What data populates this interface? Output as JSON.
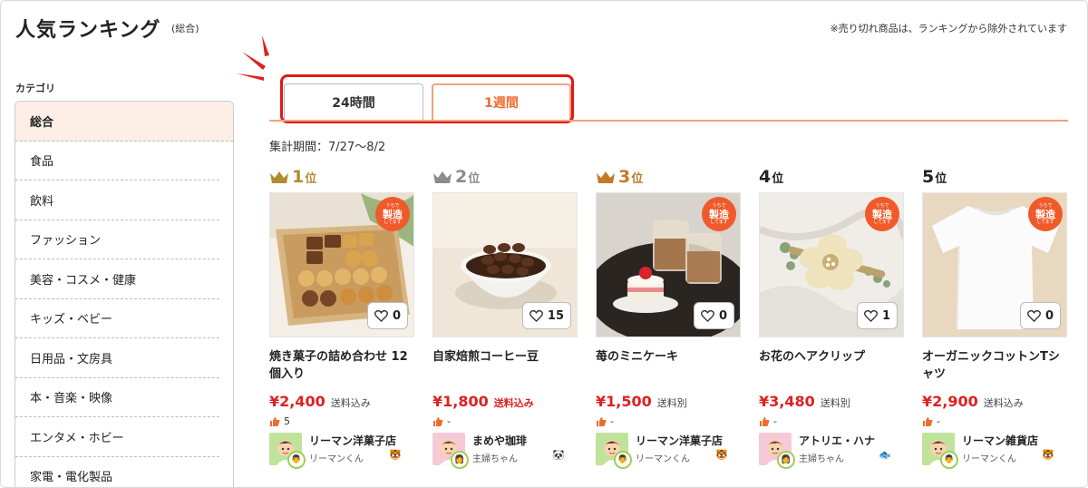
{
  "header": {
    "title": "人気ランキング",
    "subtitle": "(総合)",
    "note": "※売り切れ商品は、ランキングから除外されています"
  },
  "sidebar": {
    "heading": "カテゴリ",
    "items": [
      {
        "label": "総合",
        "active": true
      },
      {
        "label": "食品"
      },
      {
        "label": "飲料"
      },
      {
        "label": "ファッション"
      },
      {
        "label": "美容・コスメ・健康"
      },
      {
        "label": "キッズ・ベビー"
      },
      {
        "label": "日用品・文房具"
      },
      {
        "label": "本・音楽・映像"
      },
      {
        "label": "エンタメ・ホビー"
      },
      {
        "label": "家電・電化製品"
      }
    ]
  },
  "tabs": [
    {
      "label": "24時間"
    },
    {
      "label": "1週間",
      "selected": true
    }
  ],
  "period": "集計期間：7/27〜8/2",
  "badge": {
    "line1": "うちで",
    "line2": "製造",
    "line3": "してます"
  },
  "colors": {
    "accent": "#f06b2e",
    "price": "#e02020",
    "highlight": "#e01818",
    "gold": "#b08d2e",
    "silver": "#8c8c8c",
    "bronze": "#c57a2a"
  },
  "products": [
    {
      "rank": "1",
      "suffix": "位",
      "crown": "gold",
      "name": "焼き菓子の詰め合わせ 12個入り",
      "price": "¥2,400",
      "shipping": "送料込み",
      "shipping_emphasis": false,
      "favorites": "0",
      "likes": "5",
      "shop": "リーマン洋菓子店",
      "seller_type": "リーマンくん",
      "type_icon": "🐯",
      "made_badge": true,
      "image": "cookies"
    },
    {
      "rank": "2",
      "suffix": "位",
      "crown": "silver",
      "name": "自家焙煎コーヒー豆",
      "price": "¥1,800",
      "shipping": "送料込み",
      "shipping_emphasis": true,
      "favorites": "15",
      "likes": "-",
      "shop": "まめや珈琲",
      "seller_type": "主婦ちゃん",
      "type_icon": "🐼",
      "made_badge": false,
      "image": "coffee"
    },
    {
      "rank": "3",
      "suffix": "位",
      "crown": "bronze",
      "name": "苺のミニケーキ",
      "price": "¥1,500",
      "shipping": "送料別",
      "shipping_emphasis": false,
      "favorites": "0",
      "likes": "-",
      "shop": "リーマン洋菓子店",
      "seller_type": "リーマンくん",
      "type_icon": "🐯",
      "made_badge": true,
      "image": "cake"
    },
    {
      "rank": "4",
      "suffix": "位",
      "crown": "",
      "name": "お花のヘアクリップ",
      "price": "¥3,480",
      "shipping": "送料別",
      "shipping_emphasis": false,
      "favorites": "1",
      "likes": "-",
      "shop": "アトリエ・ハナ",
      "seller_type": "主婦ちゃん",
      "type_icon": "🐟",
      "made_badge": true,
      "image": "flower"
    },
    {
      "rank": "5",
      "suffix": "位",
      "crown": "",
      "name": "オーガニックコットンTシャツ",
      "price": "¥2,900",
      "shipping": "送料込み",
      "shipping_emphasis": false,
      "favorites": "0",
      "likes": "-",
      "shop": "リーマン雑貨店",
      "seller_type": "リーマンくん",
      "type_icon": "🐯",
      "made_badge": true,
      "image": "tshirt"
    }
  ]
}
